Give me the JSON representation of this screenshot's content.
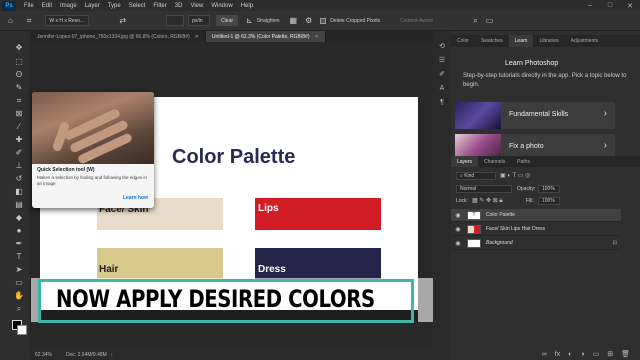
{
  "menubar": {
    "logo": "Ps",
    "items": [
      "File",
      "Edit",
      "Image",
      "Layer",
      "Type",
      "Select",
      "Filter",
      "3D",
      "View",
      "Window",
      "Help"
    ]
  },
  "options": {
    "ratio": "W x H x Reso...",
    "unit": "px/in",
    "clear": "Clear",
    "straighten": "Straighten",
    "delete_cropped": "Delete Cropped Pixels",
    "content_aware": "Content-Aware"
  },
  "tabs": [
    {
      "label": "Jennifer-Lopez-07_iphone_750x1334.jpg @ 66.8% (Colors, RGB/8#)",
      "active": false
    },
    {
      "label": "Untitled-1 @ 62.3% (Color Palette, RGB/8#)",
      "active": true
    }
  ],
  "canvas": {
    "title": "Color Palette",
    "swatches": [
      {
        "label": "Face/ Skin",
        "color": "#e8dcc8"
      },
      {
        "label": "Lips",
        "color": "#d21d26"
      },
      {
        "label": "Hair",
        "color": "#d8c98a"
      },
      {
        "label": "Dress",
        "color": "#262449"
      }
    ]
  },
  "banner": {
    "text": "NOW APPLY DESIRED COLORS",
    "frame_color": "#3db7a7"
  },
  "tooltip": {
    "title": "Quick Selection tool (W)",
    "description": "Makes a selection by finding and following the edges in an image",
    "link": "Learn how"
  },
  "status": {
    "zoom": "62.34%",
    "doc": "Doc: 2.64M/9.48M"
  },
  "panels": {
    "top_tabs": [
      "Color",
      "Swatches",
      "Learn",
      "Libraries",
      "Adjustments"
    ],
    "learn_title": "Learn Photoshop",
    "learn_desc": "Step-by-step tutorials directly in the app. Pick a topic below to begin.",
    "cards": [
      "Fundamental Skills",
      "Fix a photo"
    ],
    "bottom_tabs": [
      "Layers",
      "Channels",
      "Paths"
    ],
    "kind": "Kind",
    "blend": "Normal",
    "opacity_label": "Opacity:",
    "opacity": "100%",
    "lock_label": "Lock:",
    "fill_label": "Fill:",
    "fill": "100%",
    "layers": [
      {
        "name": "Color Palette",
        "thumb": "T",
        "selected": true
      },
      {
        "name": "Face/ Skin      Lips      Hair      Dress",
        "thumb": "",
        "selected": false
      },
      {
        "name": "Background",
        "thumb": "",
        "selected": false
      }
    ]
  },
  "colors": {
    "accent": "#31a8ff",
    "link": "#1473e6"
  }
}
